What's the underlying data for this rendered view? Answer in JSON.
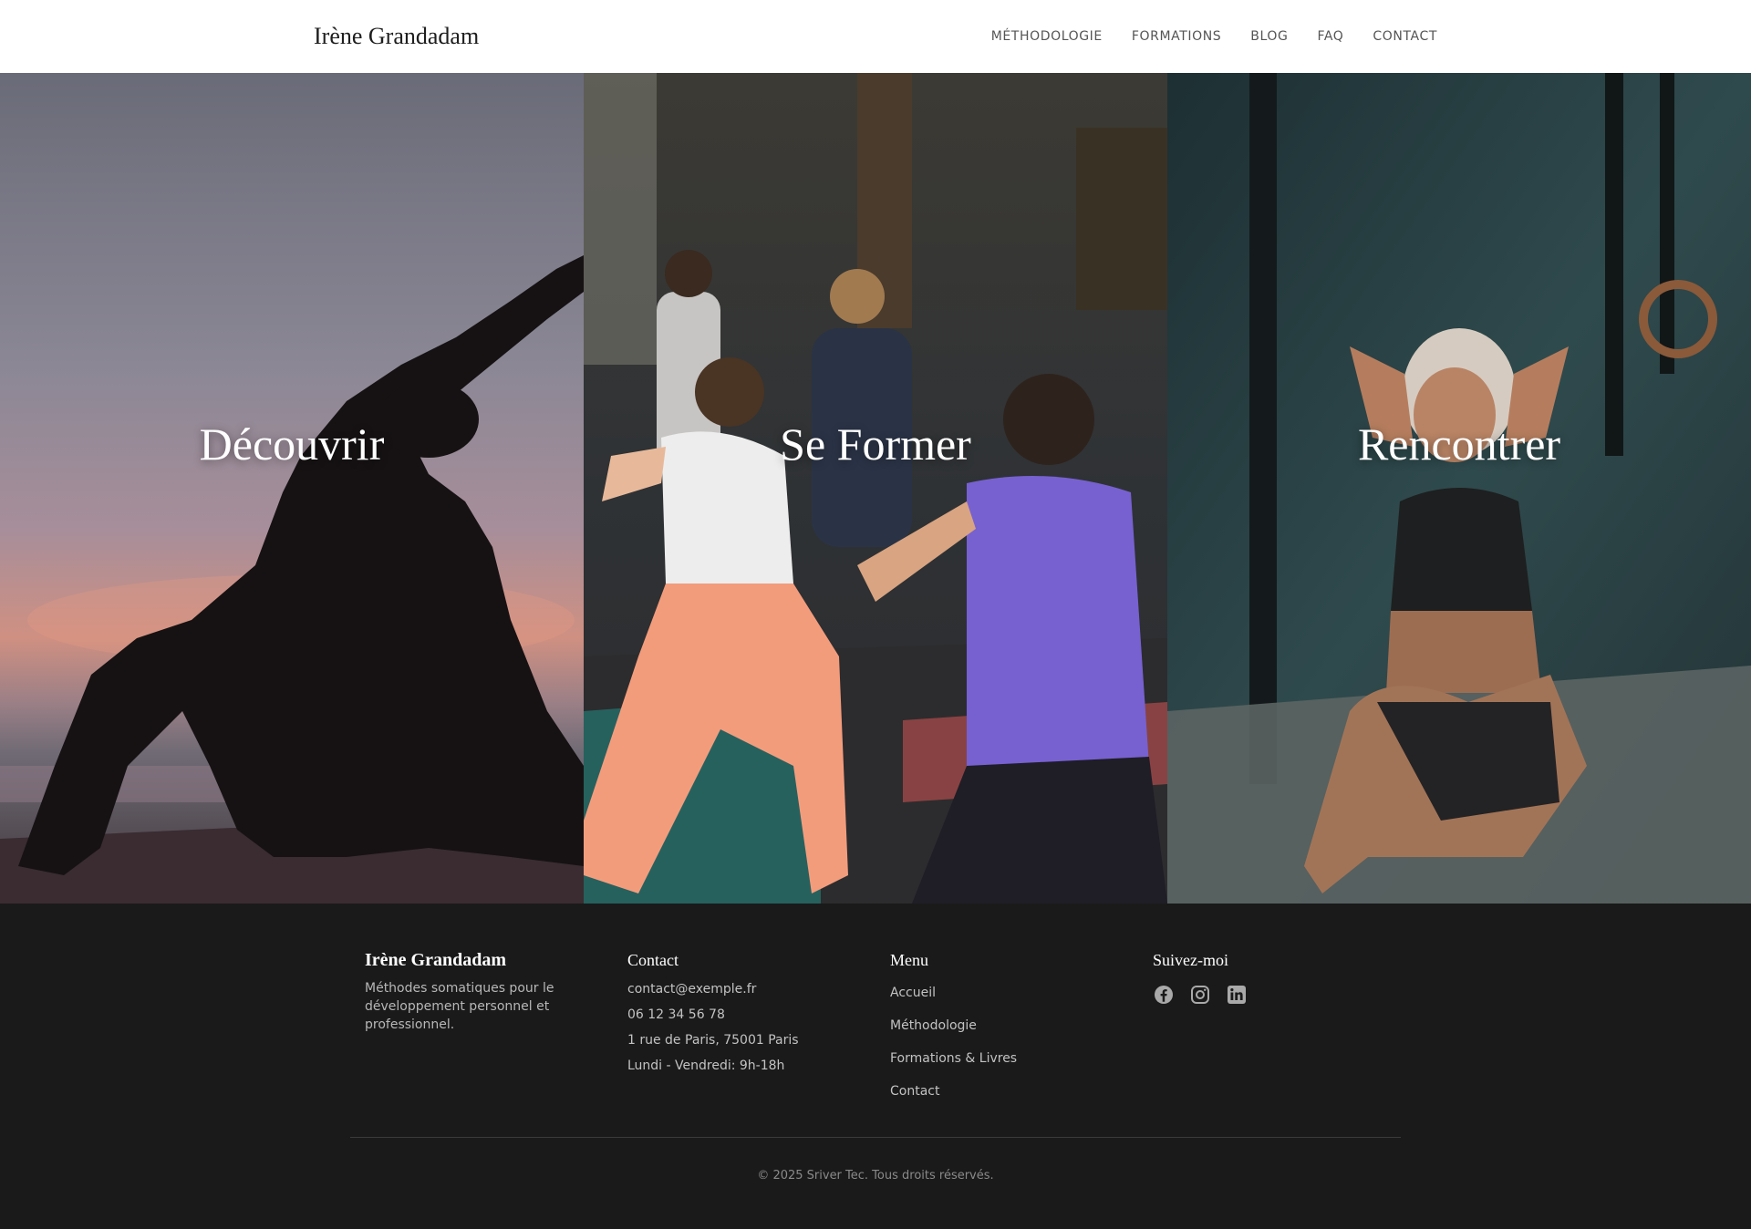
{
  "header": {
    "brand": "Irène Grandadam",
    "nav": [
      "MÉTHODOLOGIE",
      "FORMATIONS",
      "BLOG",
      "FAQ",
      "CONTACT"
    ]
  },
  "hero": {
    "panels": [
      {
        "title": "Découvrir"
      },
      {
        "title": "Se Former"
      },
      {
        "title": "Rencontrer"
      }
    ]
  },
  "footer": {
    "brand": {
      "title": "Irène Grandadam",
      "description": "Méthodes somatiques pour le développement personnel et professionnel."
    },
    "contact": {
      "title": "Contact",
      "email": "contact@exemple.fr",
      "phone": "06 12 34 56 78",
      "address": "1 rue de Paris, 75001 Paris",
      "hours": "Lundi - Vendredi: 9h-18h"
    },
    "menu": {
      "title": "Menu",
      "items": [
        "Accueil",
        "Méthodologie",
        "Formations & Livres",
        "Contact"
      ]
    },
    "social": {
      "title": "Suivez-moi",
      "icons": [
        "facebook-icon",
        "instagram-icon",
        "linkedin-icon"
      ]
    },
    "copyright": "© 2025 Sriver Tec. Tous droits réservés."
  },
  "colors": {
    "header_bg": "#ffffff",
    "footer_bg": "#1a1a1a",
    "nav_text": "#555555",
    "footer_text": "#c3c3c3"
  }
}
